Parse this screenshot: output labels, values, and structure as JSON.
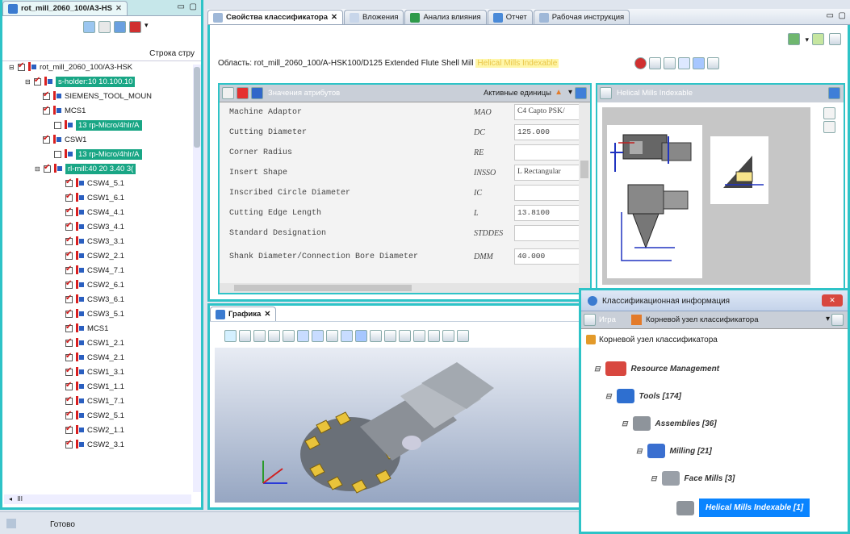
{
  "left_panel": {
    "tab_label": "rot_mill_2060_100/A3-HS",
    "column_header": "Строка стру",
    "scroll_label": "III",
    "rows": [
      {
        "label": "rot_mill_2060_100/A3-HSK",
        "hl": false
      },
      {
        "label": "s-holder:10 10.100.10",
        "hl": true
      },
      {
        "label": "SIEMENS_TOOL_MOUN",
        "hl": false
      },
      {
        "label": "MCS1",
        "hl": false
      },
      {
        "label": "13 rp-Micro/4hlr/A",
        "hl": true
      },
      {
        "label": "CSW1",
        "hl": false
      },
      {
        "label": "13 rp-Micro/4hlr/A",
        "hl": true
      },
      {
        "label": "rl-mill:40 20 3.40 3(",
        "hl": true
      },
      {
        "label": "CSW4_5.1",
        "hl": false
      },
      {
        "label": "CSW1_6.1",
        "hl": false
      },
      {
        "label": "CSW4_4.1",
        "hl": false
      },
      {
        "label": "CSW3_4.1",
        "hl": false
      },
      {
        "label": "CSW3_3.1",
        "hl": false
      },
      {
        "label": "CSW2_2.1",
        "hl": false
      },
      {
        "label": "CSW4_7.1",
        "hl": false
      },
      {
        "label": "CSW2_6.1",
        "hl": false
      },
      {
        "label": "CSW3_6.1",
        "hl": false
      },
      {
        "label": "CSW3_5.1",
        "hl": false
      },
      {
        "label": "MCS1",
        "hl": false
      },
      {
        "label": "CSW1_2.1",
        "hl": false
      },
      {
        "label": "CSW4_2.1",
        "hl": false
      },
      {
        "label": "CSW1_3.1",
        "hl": false
      },
      {
        "label": "CSW1_1.1",
        "hl": false
      },
      {
        "label": "CSW1_7.1",
        "hl": false
      },
      {
        "label": "CSW2_5.1",
        "hl": false
      },
      {
        "label": "CSW2_1.1",
        "hl": false
      },
      {
        "label": "CSW2_3.1",
        "hl": false
      }
    ]
  },
  "top_tabs": [
    {
      "label": "Свойства классификатора",
      "active": true
    },
    {
      "label": "Вложения",
      "active": false
    },
    {
      "label": "Анализ влияния",
      "active": false
    },
    {
      "label": "Отчет",
      "active": false
    },
    {
      "label": "Рабочая инструкция",
      "active": false
    }
  ],
  "classifier": {
    "scope_label": "Область: rot_mill_2060_100/A-HSK100/D125 Extended Flute Shell Mill",
    "scope_highlight": "Helical Mills Indexable",
    "attr_header": "Значения атрибутов",
    "active_units": "Активные единицы",
    "image_panel_title": "Helical Mills Indexable",
    "attributes": [
      {
        "name": "Machine Adaptor",
        "code": "MAO",
        "value": "C4 Capto PSK/"
      },
      {
        "name": "Cutting Diameter",
        "code": "DC",
        "value": "125.000"
      },
      {
        "name": "Corner Radius",
        "code": "RE",
        "value": ""
      },
      {
        "name": "Insert Shape",
        "code": "INSSO",
        "value": "L Rectangular"
      },
      {
        "name": "Inscribed Circle Diameter",
        "code": "IC",
        "value": ""
      },
      {
        "name": "Cutting Edge Length",
        "code": "L",
        "value": "13.8100"
      },
      {
        "name": "Standard Designation",
        "code": "STDDES",
        "value": ""
      },
      {
        "name": "Shank Diameter/Connection Bore Diameter",
        "code": "DMM",
        "value": "40.000"
      }
    ]
  },
  "graphics": {
    "tab_label": "Графика"
  },
  "class_info": {
    "title": "Классификационная информация",
    "search_label": "Игра",
    "root_dropdown": "Корневой узел классификатора",
    "root_item": "Корневой узел классификатора",
    "tree": [
      {
        "label": "Resource Management"
      },
      {
        "label": "Tools [174]"
      },
      {
        "label": "Assemblies [36]"
      },
      {
        "label": "Milling [21]"
      },
      {
        "label": "Face Mills [3]"
      },
      {
        "label": "Helical Mills Indexable [1]"
      }
    ]
  },
  "status": {
    "text": "Готово"
  },
  "colors": {
    "accent": "#2ec3c7",
    "highlight": "#19a685",
    "selection": "#0a84ff"
  }
}
